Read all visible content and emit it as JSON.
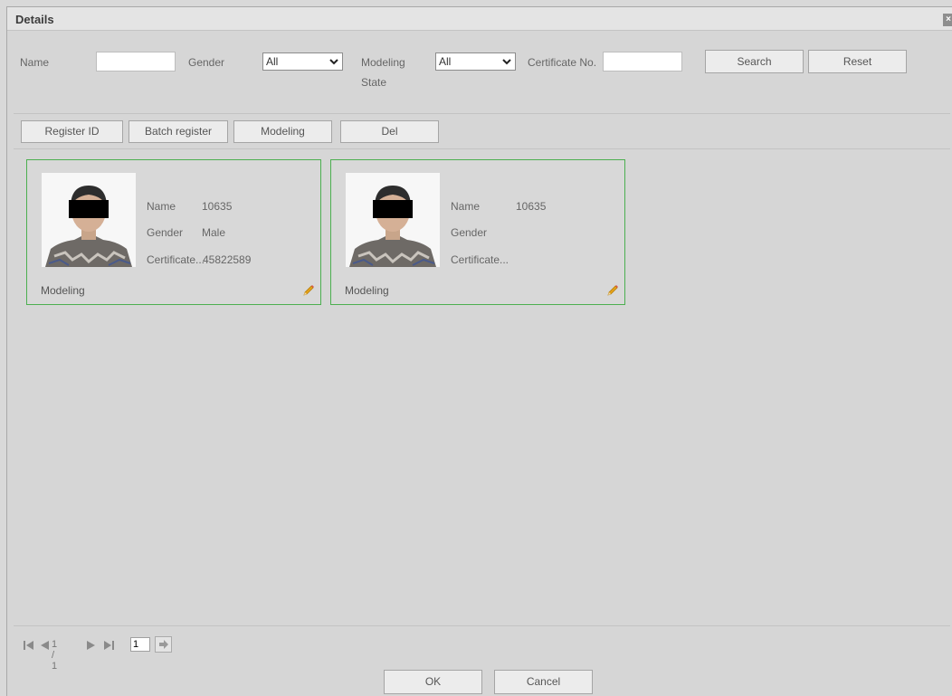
{
  "dialog": {
    "title": "Details",
    "close_glyph": "×"
  },
  "filters": {
    "name_label": "Name",
    "name_value": "",
    "gender_label": "Gender",
    "gender_value": "All",
    "modeling_label_line1": "Modeling",
    "modeling_label_line2": "State",
    "modeling_value": "All",
    "certificate_label": "Certificate No.",
    "certificate_value": "",
    "search_label": "Search",
    "reset_label": "Reset"
  },
  "toolbar": {
    "register_label": "Register ID",
    "batch_label": "Batch register",
    "modeling_label": "Modeling",
    "del_label": "Del"
  },
  "cards": [
    {
      "name_label": "Name",
      "name_value": "10635",
      "gender_label": "Gender",
      "gender_value": "Male",
      "cert_label": "Certificate...",
      "cert_value": "45822589",
      "state": "Modeling",
      "icon": "pencil-icon"
    },
    {
      "name_label": "Name",
      "name_value": "10635",
      "gender_label": "Gender",
      "gender_value": "",
      "cert_label": "Certificate...",
      "cert_value": "",
      "state": "Modeling",
      "icon": "pencil-icon"
    }
  ],
  "pagination": {
    "page_info": "1 / 1",
    "page_value": "1"
  },
  "footer": {
    "ok_label": "OK",
    "cancel_label": "Cancel"
  },
  "colors": {
    "card_border": "#4caf50",
    "background": "#d6d6d6"
  }
}
